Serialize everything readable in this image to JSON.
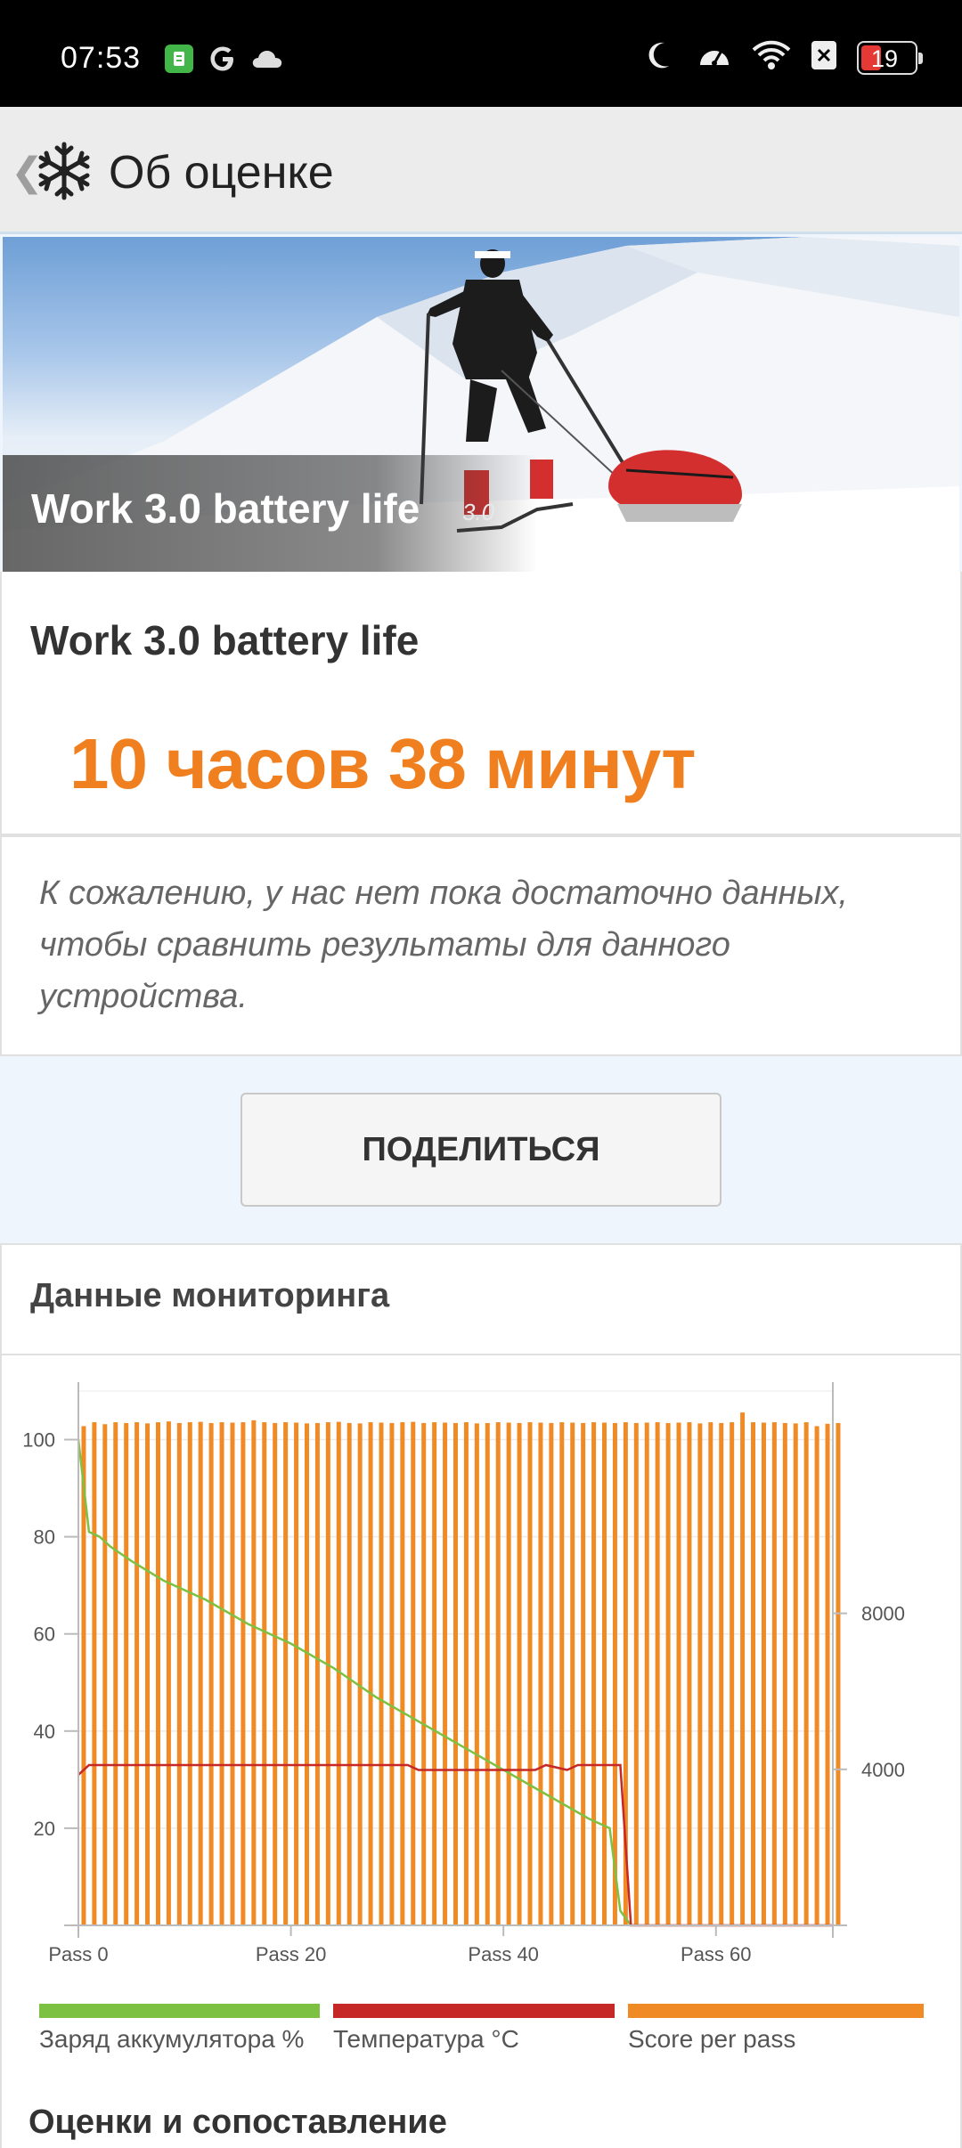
{
  "status_bar": {
    "time": "07:53",
    "battery_level": "19",
    "icons_left": [
      "app-notification-icon",
      "google-icon",
      "cloud-icon"
    ],
    "icons_right": [
      "moon-icon",
      "speedometer-icon",
      "wifi-icon",
      "close-box-icon",
      "battery-icon"
    ]
  },
  "app_bar": {
    "title": "Об оценке",
    "logo_icon": "snowflake-icon"
  },
  "hero": {
    "title": "Work 3.0 battery life",
    "version": "3.0"
  },
  "result": {
    "title": "Work 3.0 battery life",
    "value": "10 часов 38 минут"
  },
  "message": "К сожалению, у нас нет пока достаточно данных, чтобы сравнить результаты для данного устройства.",
  "share_button": "ПОДЕЛИТЬСЯ",
  "monitoring": {
    "title": "Данные мониторинга"
  },
  "chart_data": {
    "type": "bar",
    "x_ticks": [
      "Pass 0",
      "Pass 20",
      "Pass 40",
      "Pass 60"
    ],
    "x_tick_values": [
      0,
      20,
      40,
      60
    ],
    "xlim": [
      0,
      71
    ],
    "y_left_ticks": [
      "20",
      "40",
      "60",
      "80",
      "100"
    ],
    "y_left_values": [
      20,
      40,
      60,
      80,
      100
    ],
    "ylim_left": [
      0,
      110
    ],
    "y_right_ticks": [
      "4000",
      "8000"
    ],
    "y_right_values": [
      4000,
      8000
    ],
    "ylim_right": [
      0,
      13700
    ],
    "series": [
      {
        "name": "Заряд аккумулятора %",
        "type": "line",
        "axis": "left",
        "color": "#7cc142",
        "x": [
          0,
          1,
          2,
          3,
          5,
          8,
          12,
          16,
          20,
          24,
          28,
          32,
          36,
          40,
          44,
          48,
          50,
          51,
          52
        ],
        "values": [
          100,
          81,
          80,
          78,
          75,
          71,
          67,
          62,
          58,
          53,
          47,
          42,
          37,
          32,
          27,
          22,
          20,
          3,
          0
        ]
      },
      {
        "name": "Температура °C",
        "type": "line",
        "axis": "left",
        "color": "#c62828",
        "x": [
          0,
          1,
          31,
          32,
          43,
          44,
          46,
          47,
          51,
          52,
          71
        ],
        "values": [
          31,
          33,
          33,
          32,
          32,
          33,
          32,
          33,
          33,
          0,
          0
        ],
        "raw_note": ""
      },
      {
        "name": "Score per pass",
        "type": "bar",
        "axis": "right",
        "color": "#f08a24",
        "values": [
          12800,
          12900,
          12850,
          12900,
          12880,
          12900,
          12870,
          12900,
          12920,
          12880,
          12900,
          12910,
          12880,
          12900,
          12890,
          12900,
          12950,
          12900,
          12880,
          12900,
          12890,
          12870,
          12880,
          12900,
          12910,
          12880,
          12870,
          12900,
          12890,
          12880,
          12900,
          12910,
          12880,
          12900,
          12890,
          12880,
          12900,
          12870,
          12880,
          12900,
          12890,
          12880,
          12900,
          12890,
          12880,
          12900,
          12890,
          12880,
          12900,
          12890,
          12880,
          12900,
          12880,
          12890,
          12900,
          12880,
          12890,
          12900,
          12870,
          12900,
          12880,
          12900,
          13150,
          12900,
          12890,
          12900,
          12880,
          12870,
          12900,
          12800,
          12860,
          12880
        ]
      }
    ]
  },
  "legend": [
    {
      "label": "Заряд аккумулятора %",
      "color": "#7cc142"
    },
    {
      "label": "Температура °C",
      "color": "#c62828"
    },
    {
      "label": "Score per pass",
      "color": "#f08a24"
    }
  ],
  "bottom_heading": "Оценки и сопоставление"
}
